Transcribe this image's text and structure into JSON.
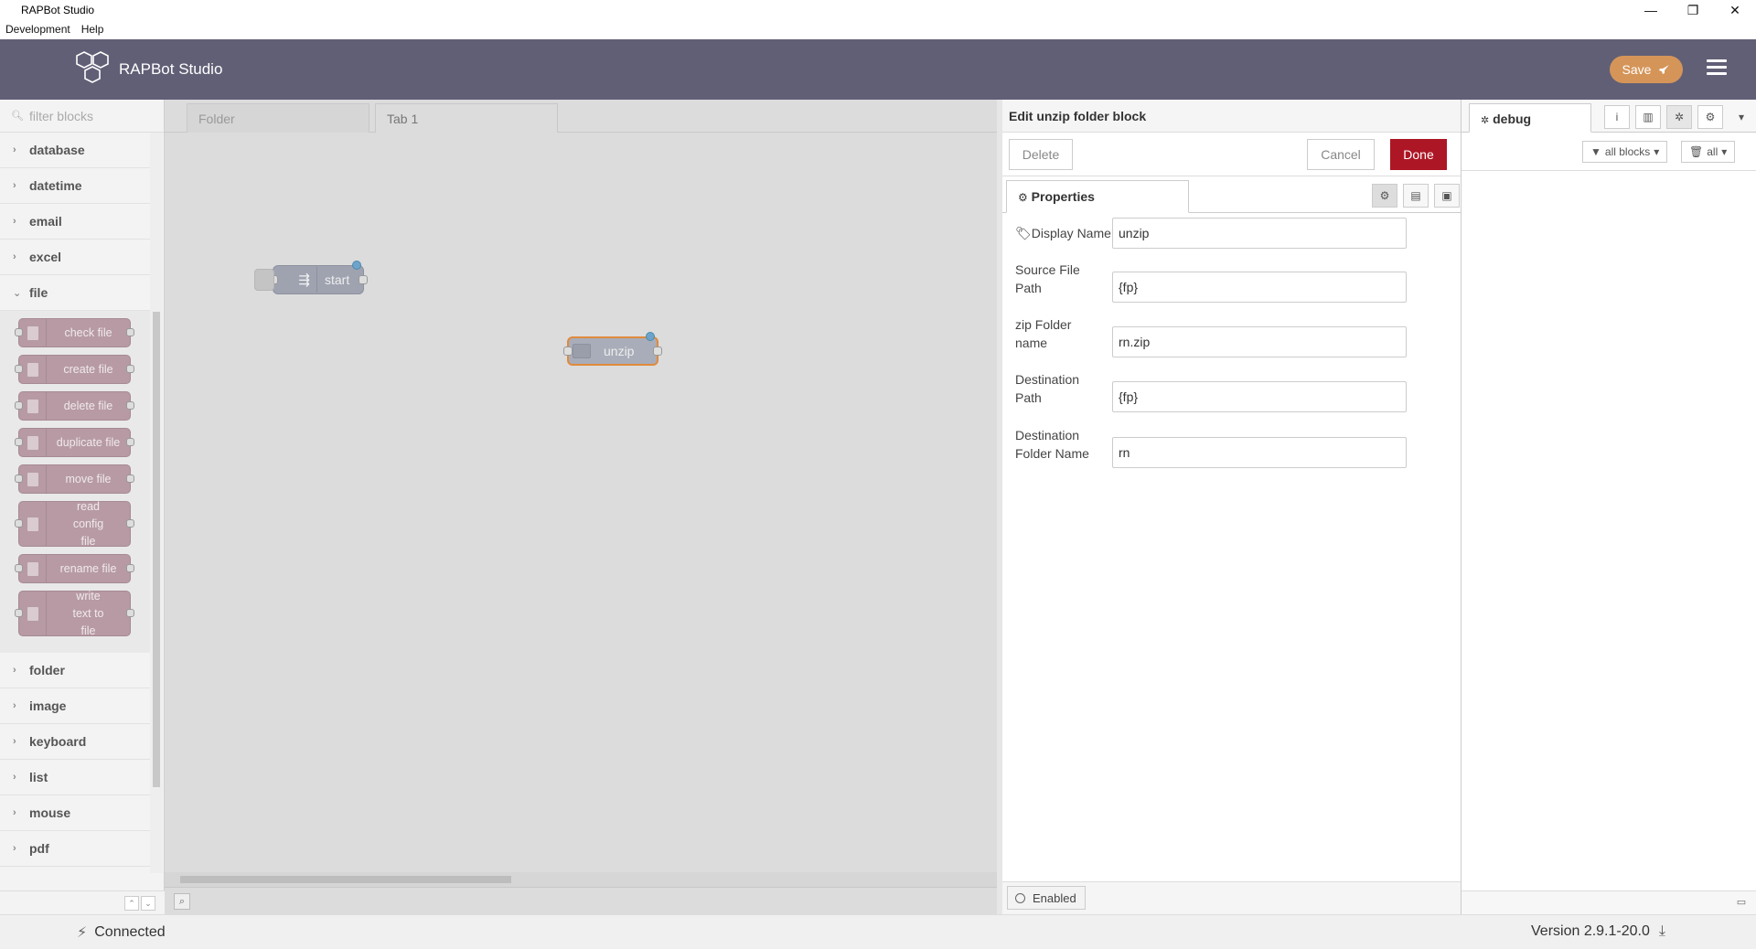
{
  "window": {
    "title": "RAPBot Studio",
    "controls": [
      "—",
      "❐",
      "✕"
    ],
    "menu": [
      "Development",
      "Help"
    ]
  },
  "header": {
    "brand": "RAPBot Studio",
    "save_label": "Save",
    "save_color": "#d59559",
    "bar_color": "#615f76"
  },
  "palette": {
    "filter_placeholder": "filter blocks",
    "categories_before": [
      "database",
      "datetime",
      "email",
      "excel",
      "file"
    ],
    "file_blocks": [
      "check file",
      "create file",
      "delete file",
      "duplicate file",
      "move file",
      "read config file",
      "rename file",
      "write text to file"
    ],
    "categories_after": [
      "folder",
      "image",
      "keyboard",
      "list",
      "mouse",
      "pdf"
    ]
  },
  "workspace": {
    "tabs": [
      "Folder",
      "Tab 1"
    ],
    "active_tab": "Tab 1",
    "nodes": [
      {
        "label": "start",
        "color": "#9fa3b0"
      },
      {
        "label": "unzip",
        "color": "#a9adb9",
        "selected_border": "#e08a3c"
      }
    ]
  },
  "tray": {
    "title": "Edit unzip folder block",
    "delete_label": "Delete",
    "cancel_label": "Cancel",
    "done_label": "Done",
    "done_color": "#ad1625",
    "properties_tab": "Properties",
    "fields": [
      {
        "label": "Display Name",
        "value": "unzip"
      },
      {
        "label": "Source File Path",
        "value": "{fp}"
      },
      {
        "label": "zip Folder name",
        "value": "rn.zip"
      },
      {
        "label": "Destination Path",
        "value": "{fp}"
      },
      {
        "label": "Destination Folder Name",
        "value": "rn"
      }
    ],
    "enabled_label": "Enabled"
  },
  "debug": {
    "tab_label": "debug",
    "filter_label": "all blocks",
    "clear_label": "all"
  },
  "status": {
    "connection": "Connected",
    "version": "Version 2.9.1-20.0"
  }
}
